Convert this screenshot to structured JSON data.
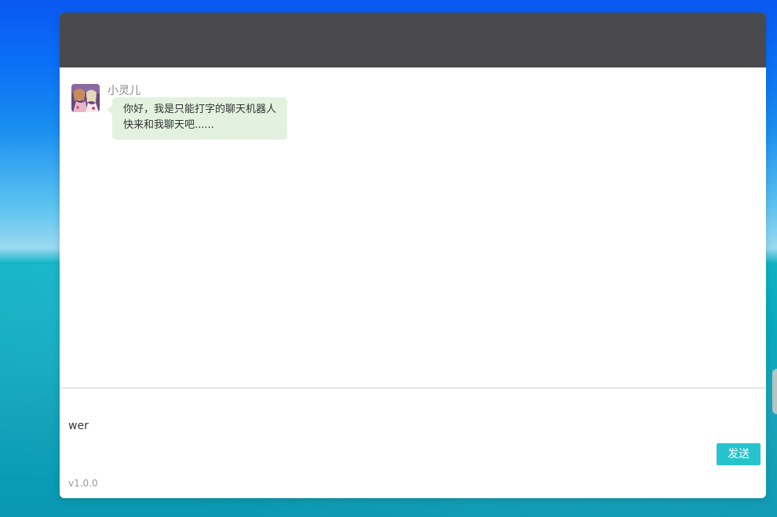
{
  "chat": {
    "sender_name": "小灵儿",
    "message_lines": [
      "你好，我是只能打字的聊天机器人",
      "快来和我聊天吧......"
    ]
  },
  "composer": {
    "input_value": "wer",
    "send_label": "发送"
  },
  "footer": {
    "version": "v1.0.0"
  },
  "colors": {
    "header": "#4a4a4c",
    "bubble": "#e2f2df",
    "send_button": "#26c3cd"
  },
  "icons": {
    "avatar": "anime-girl-avatar"
  }
}
